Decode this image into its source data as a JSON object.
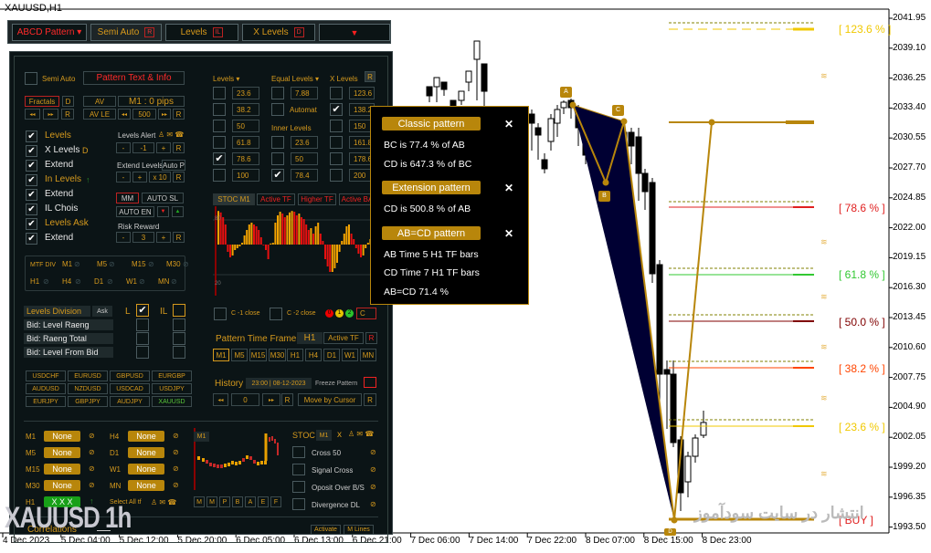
{
  "window_title": "XAUUSD,H1",
  "toolbar": {
    "abcd_pattern": "ABCD Pattern ▾",
    "semi_auto": "Semi Auto",
    "semi_auto_tag": "R",
    "levels": "Levels",
    "levels_tag": "IL",
    "x_levels": "X Levels",
    "x_levels_tag": "D",
    "dropdown_arrow": "▼"
  },
  "panel": {
    "semi_auto_label": "Semi Auto",
    "pattern_text_info": "Pattern Text & Info",
    "fractals": "Fractals",
    "fractals_tag": "D",
    "av": "AV",
    "m1_pips": "M1 : 0  pips",
    "rew": "◂◂",
    "fwd": "▸▸",
    "r": "R",
    "av_le": "AV LE",
    "av_le_value": "500",
    "checklist": [
      {
        "label": "Levels",
        "checked": true,
        "color": "#d69a1d"
      },
      {
        "label": "X Levels",
        "suffix": "D",
        "checked": true,
        "color": "#e8e8e8"
      },
      {
        "label": "Extend",
        "checked": true,
        "color": "#e8e8e8"
      },
      {
        "label": "In Levels",
        "suffix": "↑",
        "checked": true,
        "color": "#d69a1d"
      },
      {
        "label": "Extend",
        "checked": true,
        "color": "#e8e8e8"
      },
      {
        "label": "IL Chois",
        "checked": true,
        "color": "#e8e8e8"
      },
      {
        "label": "Levels Ask",
        "checked": true,
        "color": "#d69a1d"
      },
      {
        "label": "Extend",
        "checked": true,
        "color": "#e8e8e8"
      }
    ],
    "levels_alert": "Levels Alert",
    "levels_alert_value": "-1",
    "minus": "-",
    "plus": "+",
    "extend_levels": "Extend Levels",
    "auto_p": "Auto P",
    "x10": "x 10",
    "mm": "MM",
    "auto_sl": "AUTO SL",
    "auto_en": "AUTO EN",
    "risk_reward": "Risk Reward",
    "risk_reward_value": "3",
    "levels_header": "Levels ▾",
    "equal_levels_header": "Equal Levels ▾",
    "x_levels_header": "X Levels",
    "levels_values": [
      {
        "value": "23.6",
        "checked": false
      },
      {
        "value": "38.2",
        "checked": false
      },
      {
        "value": "50",
        "checked": false
      },
      {
        "value": "61.8",
        "checked": false
      },
      {
        "value": "78.6",
        "checked": true
      },
      {
        "value": "100",
        "checked": false
      }
    ],
    "equal_level_value": "7.88",
    "automat": "Automat",
    "inner_levels_header": "Inner Levels",
    "inner_levels": [
      {
        "value": "23.6",
        "checked": false
      },
      {
        "value": "50",
        "checked": false
      },
      {
        "value": "78.4",
        "checked": true
      }
    ],
    "x_levels_values": [
      {
        "value": "123.6",
        "checked": false
      },
      {
        "value": "138.2",
        "checked": true
      },
      {
        "value": "150",
        "checked": false
      },
      {
        "value": "161.8",
        "checked": false
      },
      {
        "value": "178.6",
        "checked": false
      },
      {
        "value": "200",
        "checked": false
      }
    ],
    "mtf_div": "MTF DIV",
    "mtf_row1": [
      "M1",
      "M5",
      "M15",
      "M30"
    ],
    "mtf_row2": [
      "H1",
      "H4",
      "D1",
      "W1",
      "MN"
    ],
    "levels_division": "Levels Division",
    "ask": "Ask",
    "l_label": "L",
    "il_label": "IL",
    "division_rows": [
      "Bid: Level Raeng",
      "Bid: Raeng Total",
      "Bid: Level From Bid"
    ],
    "symbols": [
      "USDCHF",
      "EURUSD",
      "GBPUSD",
      "EURGBP",
      "AUDUSD",
      "NZDUSD",
      "USDCAD",
      "USDJPY",
      "EURJPY",
      "GBPJPY",
      "AUDJPY",
      "XAUUSD"
    ],
    "active_symbol": "XAUUSD",
    "stoc_tabs": [
      "STOC M1",
      "Active TF",
      "Higher TF",
      "Active BA"
    ],
    "stoc_level_80": "80",
    "stoc_level_20": "20",
    "stoc_values": [
      92,
      88,
      75,
      55,
      -20,
      -35,
      -30,
      -15,
      -10,
      -5,
      5,
      25,
      40,
      55,
      60,
      55,
      50,
      40,
      20,
      -2,
      -15,
      -40,
      3,
      5,
      60,
      80,
      90,
      85,
      75,
      80,
      88,
      92,
      90,
      80,
      85,
      75,
      70,
      55,
      40,
      45,
      30,
      50,
      60,
      30,
      10,
      -40,
      -60,
      -75,
      -75,
      -65,
      -50,
      -20,
      10,
      30,
      50,
      55,
      30,
      15,
      -10,
      -25,
      -35,
      -30,
      -10,
      5,
      15,
      25,
      35,
      5,
      2
    ],
    "c1_close": "C -1 close",
    "c2_close": "C -2 close",
    "status_dots": [
      {
        "label": "0",
        "color": "#e00"
      },
      {
        "label": "1",
        "color": "#e6c200"
      },
      {
        "label": "2",
        "color": "#2cc22c"
      }
    ],
    "c_btn": "C",
    "pattern_time_frame": "Pattern Time Frame",
    "ptf_value": "H1",
    "active_tf": "Active TF",
    "timeframes": [
      "M1",
      "M5",
      "M15",
      "M30",
      "H1",
      "H4",
      "D1",
      "W1",
      "MN"
    ],
    "active_timeframe": "M1",
    "history": "History",
    "history_value": "23:00 | 08-12-2023",
    "freeze_pattern": "Freeze Pattern",
    "history_counter": "0",
    "move_by_cursor": "Move by Cursor",
    "tf_status_left": [
      {
        "tf": "M1",
        "value": "None"
      },
      {
        "tf": "M5",
        "value": "None"
      },
      {
        "tf": "M15",
        "value": "None"
      },
      {
        "tf": "M30",
        "value": "None"
      },
      {
        "tf": "H1",
        "value": "X X X",
        "active": true
      }
    ],
    "tf_status_right": [
      {
        "tf": "H4",
        "value": "None"
      },
      {
        "tf": "D1",
        "value": "None"
      },
      {
        "tf": "W1",
        "value": "None"
      },
      {
        "tf": "MN",
        "value": "None"
      }
    ],
    "select_all_tf": "Select All tf",
    "mini_chart_label": "M1",
    "mini_buttons": [
      "M",
      "M",
      "P",
      "B",
      "A",
      "E",
      "F"
    ],
    "stoc_label": "STOC",
    "stoc_tf": "M1",
    "stoc_x": "x",
    "stoc_options": [
      "Cross 50",
      "Signal Cross",
      "Oposit Over B/S",
      "Divergence  DL"
    ],
    "correlations": "Correlations",
    "activate": "Activate",
    "m_lines": "M Lines"
  },
  "info_box": {
    "classic_header": "Classic pattern",
    "bc_line": "BC is  77.4 % of AB",
    "cd_bc_line": "CD is  647.3 % of BC",
    "extension_header": "Extension pattern",
    "cd_ab_line": "CD is  500.8 % of AB",
    "abcd_header": "AB=CD pattern",
    "ab_time": "AB Time   5  H1 TF bars",
    "cd_time": "CD Time   7  H1 TF bars",
    "abcd_ratio": "AB=CD    71.4 %",
    "close": "✕"
  },
  "chart": {
    "symbol": "XAUUSD",
    "timeframe": "H1",
    "y_ticks": [
      "2041.95",
      "2039.10",
      "2036.25",
      "2033.40",
      "2030.55",
      "2027.70",
      "2024.85",
      "2022.00",
      "2019.15",
      "2016.30",
      "2013.45",
      "2010.60",
      "2007.75",
      "2004.90",
      "2002.05",
      "1999.20",
      "1996.35",
      "1993.50"
    ],
    "x_ticks": [
      "4 Dec 2023",
      "5 Dec 04:00",
      "5 Dec 12:00",
      "5 Dec 20:00",
      "6 Dec 05:00",
      "6 Dec 13:00",
      "6 Dec 21:00",
      "7 Dec 06:00",
      "7 Dec 14:00",
      "7 Dec 22:00",
      "8 Dec 07:00",
      "8 Dec 15:00",
      "8 Dec 23:00"
    ],
    "pattern_points": [
      "A",
      "B",
      "C",
      "D"
    ],
    "levels": [
      {
        "label": "[ 123.6 % ]",
        "color": "#f0c800"
      },
      {
        "label": "[ 78.6 % ]",
        "color": "#e02020"
      },
      {
        "label": "[ 61.8 % ]",
        "color": "#32c832"
      },
      {
        "label": "[ 50.0 % ]",
        "color": "#800000"
      },
      {
        "label": "[ 38.2 % ]",
        "color": "#ff4500"
      },
      {
        "label": "[ 23.6 % ]",
        "color": "#f0c800"
      },
      {
        "label": "[ BUY ]",
        "color": "#e02020"
      }
    ],
    "watermark": "XAUUSD   1h",
    "site_watermark": "انتشار در سایت سودآموز"
  },
  "colors": {
    "gold": "#b8860b",
    "panel_bg": "#0b1416",
    "accent_orange": "#d69a1d",
    "pattern_fill": "#000033"
  }
}
